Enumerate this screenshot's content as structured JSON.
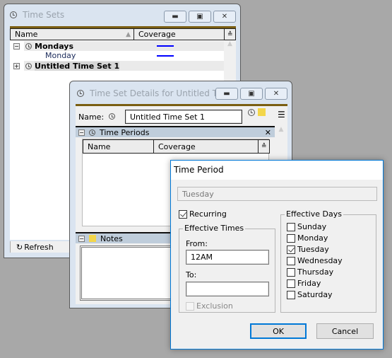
{
  "time_sets": {
    "title": "Time Sets",
    "columns": [
      "Name",
      "Coverage"
    ],
    "rows": [
      {
        "label": "Mondays",
        "bold": true,
        "expander": "-",
        "coverage_color": "#0000ff"
      },
      {
        "label": "Monday",
        "bold": false,
        "coverage_color": "#0000ff"
      },
      {
        "label": "Untitled Time Set 1",
        "bold": true,
        "expander": "+",
        "selected": true
      }
    ],
    "refresh_label": "Refresh"
  },
  "details": {
    "title": "Time Set Details for Untitled Ti...",
    "name_label": "Name:",
    "name_value": "Untitled Time Set 1",
    "periods_section": "Time Periods",
    "periods_columns": [
      "Name",
      "Coverage"
    ],
    "notes_section": "Notes"
  },
  "dialog": {
    "title": "Time Period",
    "name_value": "Tuesday",
    "recurring_label": "Recurring",
    "recurring_checked": true,
    "effective_times_label": "Effective Times",
    "from_label": "From:",
    "from_value": "12AM",
    "to_label": "To:",
    "to_value": "",
    "exclusion_label": "Exclusion",
    "effective_days_label": "Effective Days",
    "days": [
      {
        "label": "Sunday",
        "checked": false
      },
      {
        "label": "Monday",
        "checked": false
      },
      {
        "label": "Tuesday",
        "checked": true
      },
      {
        "label": "Wednesday",
        "checked": false
      },
      {
        "label": "Thursday",
        "checked": false
      },
      {
        "label": "Friday",
        "checked": false
      },
      {
        "label": "Saturday",
        "checked": false
      }
    ],
    "ok_label": "OK",
    "cancel_label": "Cancel"
  },
  "colors": {
    "accent_brown": "#7a5e12",
    "dialog_focus": "#0078d7",
    "coverage": "#0000ff"
  }
}
